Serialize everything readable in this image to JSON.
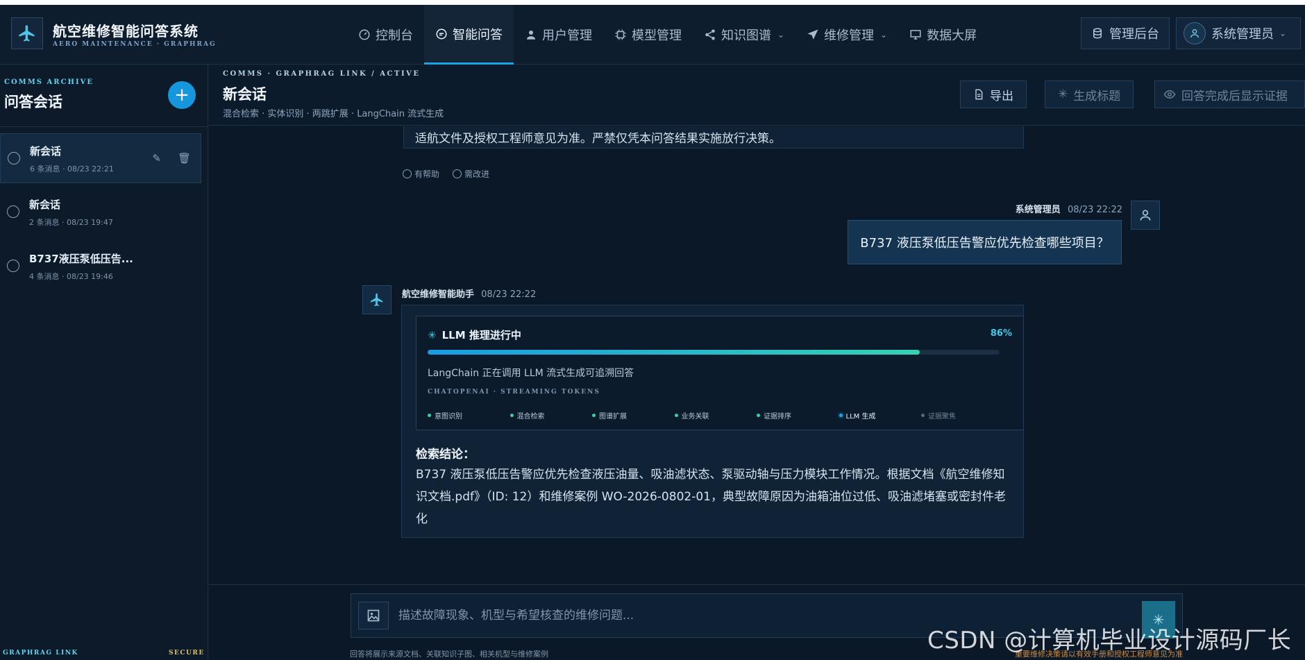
{
  "header": {
    "brand_title": "航空维修智能问答系统",
    "brand_subtitle": "AERO MAINTENANCE · GRAPHRAG",
    "nav": [
      {
        "label": "控制台",
        "icon": "gauge-icon"
      },
      {
        "label": "智能问答",
        "icon": "chat-icon",
        "active": true
      },
      {
        "label": "用户管理",
        "icon": "user-icon"
      },
      {
        "label": "模型管理",
        "icon": "chip-icon"
      },
      {
        "label": "知识图谱",
        "icon": "share-icon",
        "dropdown": true
      },
      {
        "label": "维修管理",
        "icon": "paper-plane-icon",
        "dropdown": true
      },
      {
        "label": "数据大屏",
        "icon": "monitor-icon"
      }
    ],
    "admin_button": "管理后台",
    "user_name": "系统管理员"
  },
  "sidebar": {
    "eyebrow": "COMMS ARCHIVE",
    "title": "问答会话",
    "add_label": "+",
    "conversations": [
      {
        "title": "新会话",
        "meta": "6 条消息 · 08/23 22:21",
        "active": true
      },
      {
        "title": "新会话",
        "meta": "2 条消息 · 08/23 19:47"
      },
      {
        "title": "B737液压泵低压告...",
        "meta": "4 条消息 · 08/23 19:46"
      }
    ],
    "footer_left": "GRAPHRAG LINK",
    "footer_right": "SECURE"
  },
  "main_header": {
    "eyebrow": "COMMS · GRAPHRAG LINK / ACTIVE",
    "title": "新会话",
    "subtitle": "混合检索 · 实体识别 · 两跳扩展 · LangChain 流式生成",
    "export_label": "导出",
    "gen_title_label": "生成标题",
    "evidence_label": "回答完成后显示证据"
  },
  "chat": {
    "prev_tail": "适航文件及授权工程师意见为准。严禁仅凭本问答结果实施放行决策。",
    "feedback_helpful": "有帮助",
    "feedback_improve": "需改进",
    "user_msg": {
      "name": "系统管理员",
      "time": "08/23 22:22",
      "text": "B737 液压泵低压告警应优先检查哪些项目？"
    },
    "assistant_msg": {
      "name": "航空维修智能助手",
      "time": "08/23 22:22",
      "progress_title": "LLM 推理进行中",
      "progress_pct_label": "86%",
      "progress_value": 0.86,
      "progress_desc": "LangChain 正在调用 LLM 流式生成可追溯回答",
      "progress_mono": "CHATOPENAI · STREAMING TOKENS",
      "steps": [
        {
          "label": "意图识别",
          "state": "done"
        },
        {
          "label": "混合检索",
          "state": "done"
        },
        {
          "label": "图谱扩展",
          "state": "done"
        },
        {
          "label": "业务关联",
          "state": "done"
        },
        {
          "label": "证据排序",
          "state": "done"
        },
        {
          "label": "LLM 生成",
          "state": "current"
        },
        {
          "label": "证据聚焦",
          "state": "pending"
        }
      ],
      "answer_title": "检索结论：",
      "answer_text": "B737 液压泵低压告警应优先检查液压油量、吸油滤状态、泵驱动轴与压力模块工作情况。根据文档《航空维修知识文档.pdf》（ID: 12）和维修案例 WO-2026-0802-01，典型故障原因为油箱油位过低、吸油滤堵塞或密封件老化"
    }
  },
  "composer": {
    "placeholder": "描述故障现象、机型与希望核查的维修问题...",
    "hint_left": "回答将展示来源文档、关联知识子图、相关机型与维修案例",
    "hint_right": "重要维修决策请以有效手册和授权工程师意见为准"
  },
  "watermark": "CSDN @计算机毕业设计源码厂长",
  "colors": {
    "accent": "#1ba3e8",
    "background": "#0b1a2b",
    "progress_start": "#1c9be3",
    "progress_end": "#37d0b4",
    "warning": "#d08a3a"
  }
}
